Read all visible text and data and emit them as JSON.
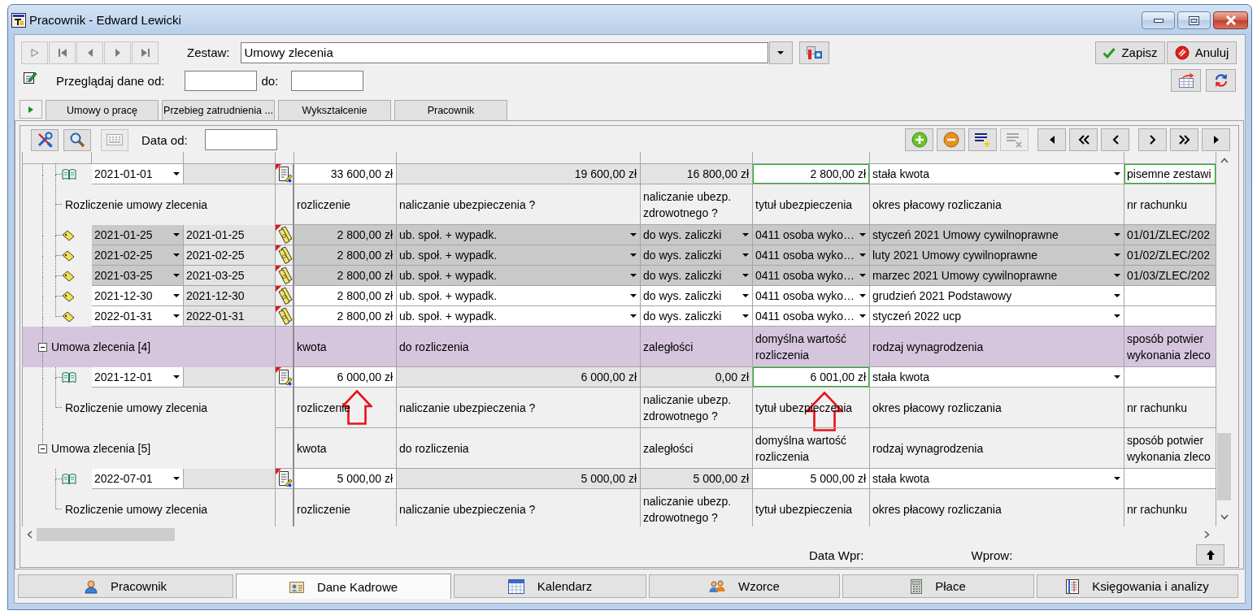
{
  "window": {
    "title": "Pracownik - Edward Lewicki"
  },
  "record_nav": [
    {
      "disabled": true
    },
    {
      "disabled": true
    },
    {
      "disabled": true
    },
    {
      "disabled": true
    },
    {
      "disabled": true
    }
  ],
  "set_selector": {
    "label": "Zestaw:",
    "value": "Umowy zlecenia"
  },
  "actions": [
    {
      "label": "Zapisz"
    },
    {
      "label": "Anuluj"
    }
  ],
  "date_filter": {
    "from_label": "Przeglądaj dane od:",
    "to_label": "do:"
  },
  "tabs": [
    {
      "label": "Umowy o pracę",
      "selected": false
    },
    {
      "label": "Przebieg zatrudnienia ...",
      "selected": false
    },
    {
      "label": "Wykształcenie",
      "selected": false
    },
    {
      "label": "Pracownik",
      "selected": false
    }
  ],
  "panel": {
    "tool_buttons": [
      {
        "disabled": false
      },
      {
        "disabled": false
      },
      {
        "disabled": true
      }
    ],
    "date_label": "Data od:",
    "row_buttons": [
      {
        "disabled": false
      },
      {
        "disabled": false
      },
      {
        "disabled": false
      },
      {
        "disabled": true
      }
    ],
    "groups": [
      {
        "children": [
          {
            "kind": "contract",
            "date": "2021-01-01",
            "amount": "33 600,00 zł",
            "to_settle": "19 600,00 zł",
            "arrears": "16 800,00 zł",
            "default_value": {
              "text": "2 800,00 zł",
              "highlighted": true
            },
            "pay_type": "stała kwota",
            "confirmation": {
              "text": "pisemne zestawi",
              "highlighted": true
            }
          },
          {
            "kind": "settlement_header",
            "label": "Rozliczenie umowy zlecenia",
            "column_labels": [
              "rozliczenie",
              "naliczanie ubezpieczenia ?",
              "naliczanie ubezp. zdrowotnego ?",
              "tytuł ubezpieczenia",
              "okres płacowy rozliczania",
              "nr rachunku"
            ]
          },
          {
            "kind": "settlement",
            "settled": true,
            "date_from": "2021-01-25",
            "date_to": "2021-01-25",
            "amount": "2 800,00 zł",
            "insurance": "ub. społ. + wypadk.",
            "health": "do wys. zaliczki",
            "title": "0411 osoba wyko…",
            "period": "styczeń 2021 Umowy cywilnoprawne",
            "account": "01/01/ZLEC/202"
          },
          {
            "kind": "settlement",
            "settled": true,
            "date_from": "2021-02-25",
            "date_to": "2021-02-25",
            "amount": "2 800,00 zł",
            "insurance": "ub. społ. + wypadk.",
            "health": "do wys. zaliczki",
            "title": "0411 osoba wyko…",
            "period": "luty 2021 Umowy cywilnoprawne",
            "account": "01/02/ZLEC/202"
          },
          {
            "kind": "settlement",
            "settled": true,
            "date_from": "2021-03-25",
            "date_to": "2021-03-25",
            "amount": "2 800,00 zł",
            "insurance": "ub. społ. + wypadk.",
            "health": "do wys. zaliczki",
            "title": "0411 osoba wyko…",
            "period": "marzec 2021 Umowy cywilnoprawne",
            "account": "01/03/ZLEC/202"
          },
          {
            "kind": "settlement",
            "settled": false,
            "date_from": "2021-12-30",
            "date_to": "2021-12-30",
            "amount": "2 800,00 zł",
            "insurance": "ub. społ. + wypadk.",
            "health": "do wys. zaliczki",
            "title": "0411 osoba wyko…",
            "period": "grudzień 2021 Podstawowy"
          },
          {
            "kind": "settlement",
            "settled": false,
            "date_from": "2022-01-31",
            "date_to": "2022-01-31",
            "amount": "2 800,00 zł",
            "insurance": "ub. społ. + wypadk.",
            "health": "do wys. zaliczki",
            "title": "0411 osoba wyko…",
            "period": "styczeń 2022 ucp"
          }
        ]
      },
      {
        "title": "Umowa zlecenia [4]",
        "selected": true,
        "expanded": true,
        "column_labels": [
          "kwota",
          "do rozliczenia",
          "zaległości",
          "domyślna wartość rozliczenia",
          "rodzaj wynagrodzenia",
          "sposób potwier\nwykonania zleco"
        ],
        "children": [
          {
            "kind": "contract",
            "date": "2021-12-01",
            "amount": "6 000,00 zł",
            "to_settle": "6 000,00 zł",
            "arrears": "0,00 zł",
            "default_value": {
              "text": "6 001,00 zł",
              "highlighted": true
            },
            "pay_type": "stała kwota",
            "confirmation": {
              "highlighted": false
            }
          },
          {
            "kind": "settlement_header",
            "label": "Rozliczenie umowy zlecenia",
            "column_labels": [
              "rozliczenie",
              "naliczanie ubezpieczenia ?",
              "naliczanie ubezp. zdrowotnego ?",
              "tytuł ubezpieczenia",
              "okres płacowy rozliczania",
              "nr rachunku"
            ]
          }
        ]
      },
      {
        "title": "Umowa zlecenia [5]",
        "selected": false,
        "expanded": true,
        "column_labels": [
          "kwota",
          "do rozliczenia",
          "zaległości",
          "domyślna wartość rozliczenia",
          "rodzaj wynagrodzenia",
          "sposób potwier\nwykonania zleco"
        ],
        "children": [
          {
            "kind": "contract",
            "date": "2022-07-01",
            "amount": "5 000,00 zł",
            "to_settle": "5 000,00 zł",
            "arrears": "5 000,00 zł",
            "default_value": {
              "text": "5 000,00 zł",
              "highlighted": false
            },
            "pay_type": "stała kwota",
            "confirmation": {
              "highlighted": false
            }
          },
          {
            "kind": "settlement_header",
            "label": "Rozliczenie umowy zlecenia",
            "column_labels": [
              "rozliczenie",
              "naliczanie ubezpieczenia ?",
              "naliczanie ubezp. zdrowotnego ?",
              "tytuł ubezpieczenia",
              "okres płacowy rozliczania",
              "nr rachunku"
            ]
          }
        ]
      }
    ],
    "footer": {
      "entry_date_label": "Data Wpr:",
      "entered_by_label": "Wprow:"
    }
  },
  "bottom_tabs": [
    {
      "label": "Pracownik",
      "selected": false
    },
    {
      "label": "Dane Kadrowe",
      "selected": true
    },
    {
      "label": "Kalendarz",
      "selected": false
    },
    {
      "label": "Wzorce",
      "selected": false
    },
    {
      "label": "Płace",
      "selected": false
    },
    {
      "label": "Księgowania i analizy",
      "selected": false
    }
  ]
}
